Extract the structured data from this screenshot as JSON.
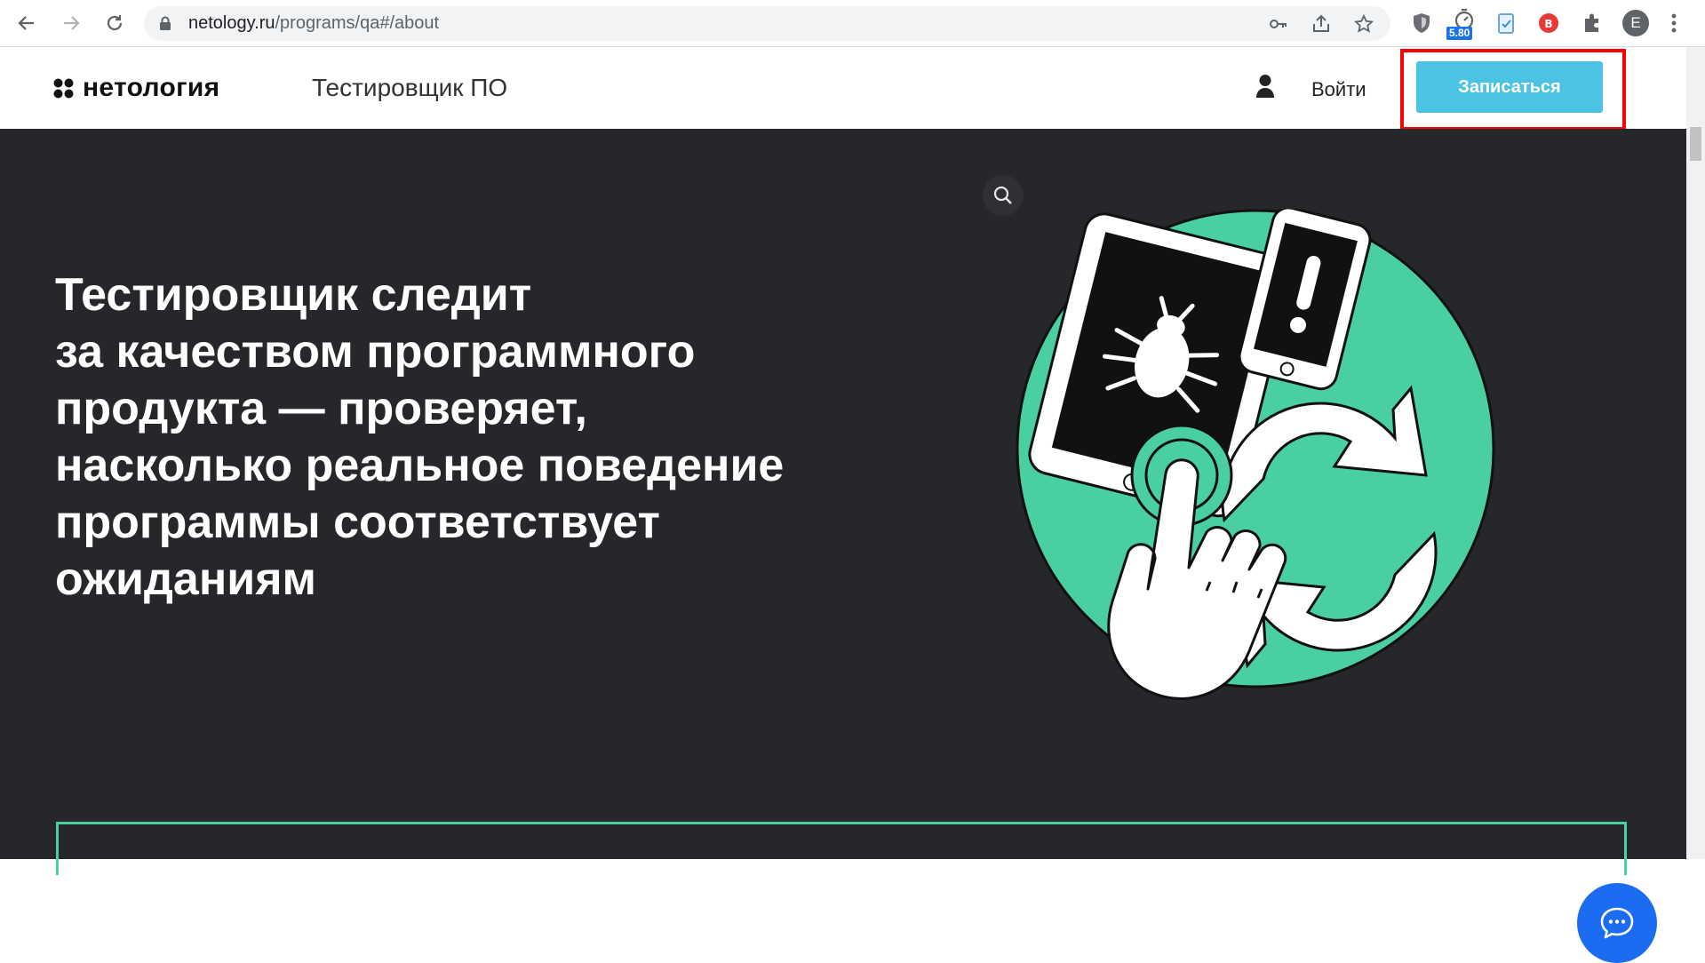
{
  "browser": {
    "url_domain": "netology.ru",
    "url_path": "/programs/qa#/about",
    "extension_badge": "5.80",
    "profile_initial": "E"
  },
  "header": {
    "logo_text": "нетология",
    "course_title": "Тестировщик ПО",
    "login_label": "Войти",
    "signup_label": "Записаться"
  },
  "hero": {
    "heading": "Тестировщик следит\nза качеством программного\nпродукта — проверяет,\nнасколько реальное поведение\nпрограммы соответствует\nожиданиям"
  },
  "colors": {
    "accent": "#4dc3e3",
    "hero_bg": "#26272b",
    "illustration_green": "#4acfa0",
    "chat_button": "#1c6cf2",
    "annotation_red": "#ff0000"
  },
  "icons": {
    "back": "back-arrow-icon",
    "forward": "forward-arrow-icon",
    "reload": "reload-icon",
    "lock": "lock-icon",
    "key": "key-icon",
    "share": "share-icon",
    "star": "bookmark-star-icon",
    "extensions": "puzzle-icon",
    "menu": "kebab-menu-icon",
    "user": "user-icon",
    "zoom": "magnifier-icon",
    "chat": "chat-bubble-icon"
  }
}
